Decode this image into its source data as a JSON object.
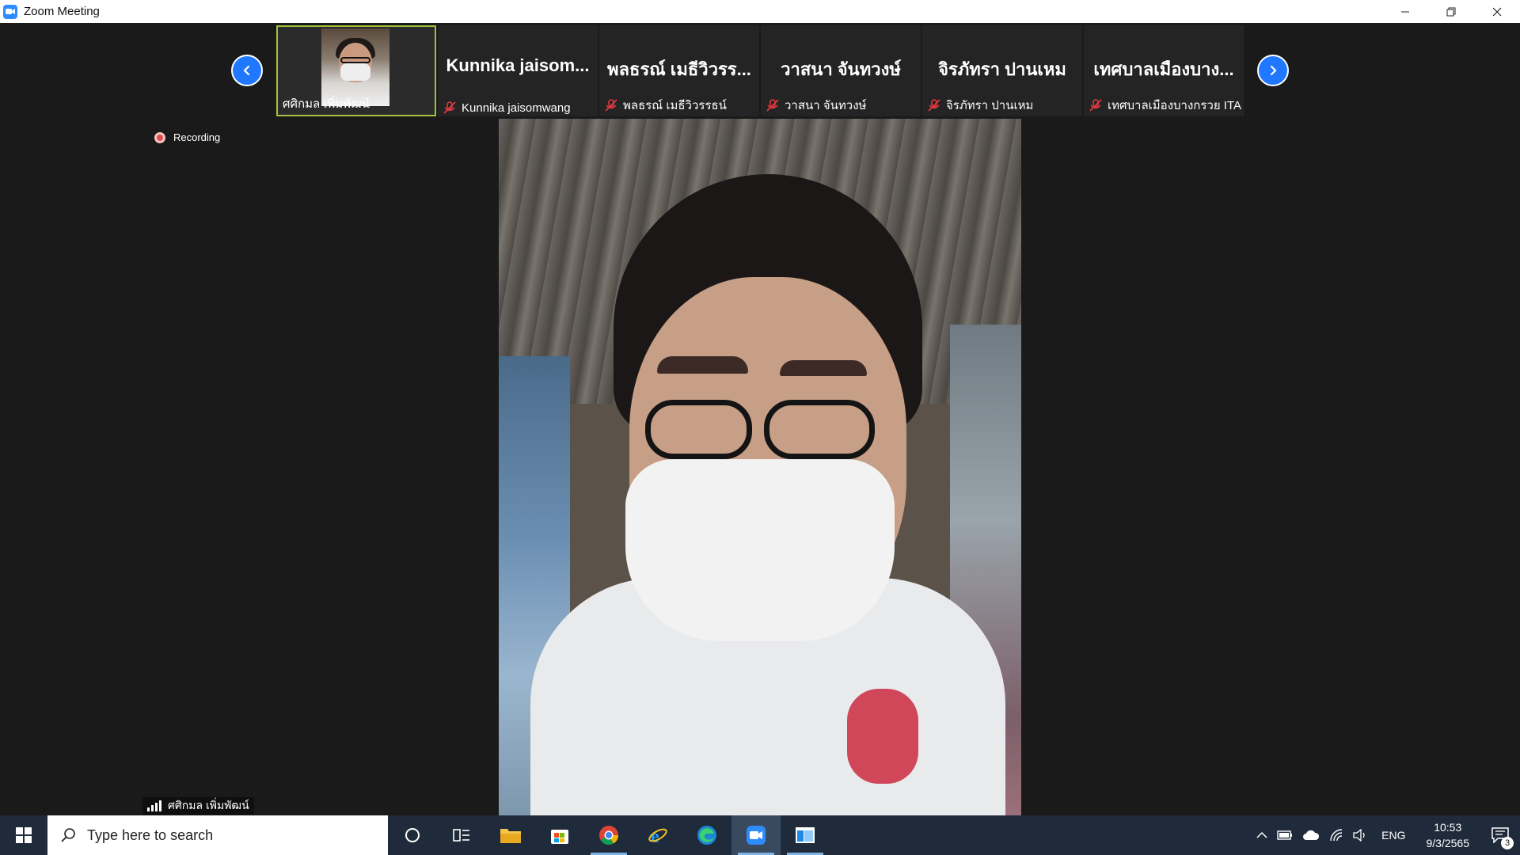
{
  "window": {
    "title": "Zoom Meeting"
  },
  "strip": {
    "active": {
      "name": "ศศิกมล เพิ่มพัฒน์"
    },
    "participants": [
      {
        "display": "Kunnika  jaisom...",
        "name": "Kunnika jaisomwang"
      },
      {
        "display": "พลธรณ์ เมธีวิวรร...",
        "name": "พลธรณ์ เมธีวิวรรธน์"
      },
      {
        "display": "วาสนา จันทวงษ์",
        "name": "วาสนา จันทวงษ์"
      },
      {
        "display": "จิรภัทรา ปานเหม",
        "name": "จิรภัทรา ปานเหม"
      },
      {
        "display": "เทศบาลเมืองบาง...",
        "name": "เทศบาลเมืองบางกรวย ITA"
      }
    ]
  },
  "recording": {
    "label": "Recording"
  },
  "speaker": {
    "name": "ศศิกมล เพิ่มพัฒน์"
  },
  "taskbar": {
    "search_placeholder": "Type here to search",
    "language": "ENG",
    "time": "10:53",
    "date": "9/3/2565",
    "notification_count": "3"
  },
  "colors": {
    "accent": "#1f78ff",
    "active_border": "#a3c23a",
    "recording": "#e24b4b"
  }
}
